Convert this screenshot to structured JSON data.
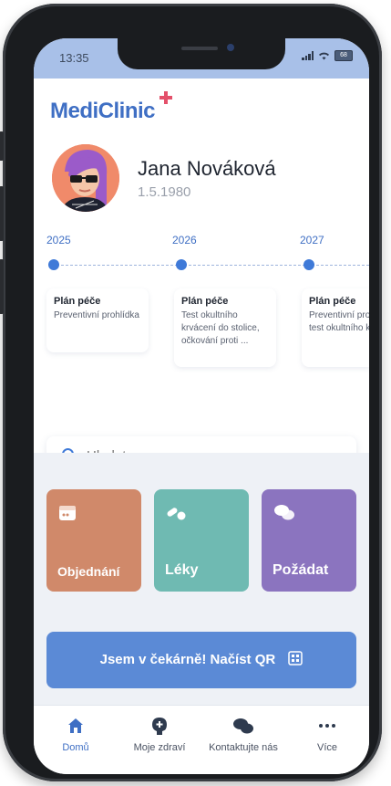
{
  "status_bar": {
    "time": "13:35",
    "battery": "68"
  },
  "app": {
    "logo_text": "MediClinic"
  },
  "profile": {
    "name": "Jana Nováková",
    "birth_date": "1.5.1980"
  },
  "timeline": {
    "years": [
      "2025",
      "2026",
      "2027"
    ],
    "cards": [
      {
        "title": "Plán péče",
        "text": "Preventivní prohlídka"
      },
      {
        "title": "Plán péče",
        "text": "Test okultního krvácení do stolice, očkování proti ..."
      },
      {
        "title": "Plán péče",
        "text": "Preventivní prohlídka, test okultního krv"
      }
    ]
  },
  "search": {
    "placeholder": "Hledat"
  },
  "tiles": [
    {
      "label": "Objednání",
      "icon": "calendar-icon",
      "color": "#d0896a"
    },
    {
      "label": "Léky",
      "icon": "pills-icon",
      "color": "#6fbab2"
    },
    {
      "label": "Požádat",
      "icon": "chat-icon",
      "color": "#8b74bf"
    }
  ],
  "qr_button": {
    "label": "Jsem v čekárně! Načíst QR"
  },
  "tabbar": {
    "items": [
      {
        "label": "Domů",
        "icon": "home-icon",
        "active": true
      },
      {
        "label": "Moje zdraví",
        "icon": "health-icon",
        "active": false
      },
      {
        "label": "Kontaktujte nás",
        "icon": "chat-icon",
        "active": false
      },
      {
        "label": "Více",
        "icon": "more-icon",
        "active": false
      }
    ]
  },
  "colors": {
    "accent": "#3f6fc4",
    "status_bar": "#a8c0e8",
    "qr_button": "#5b8ad6"
  }
}
